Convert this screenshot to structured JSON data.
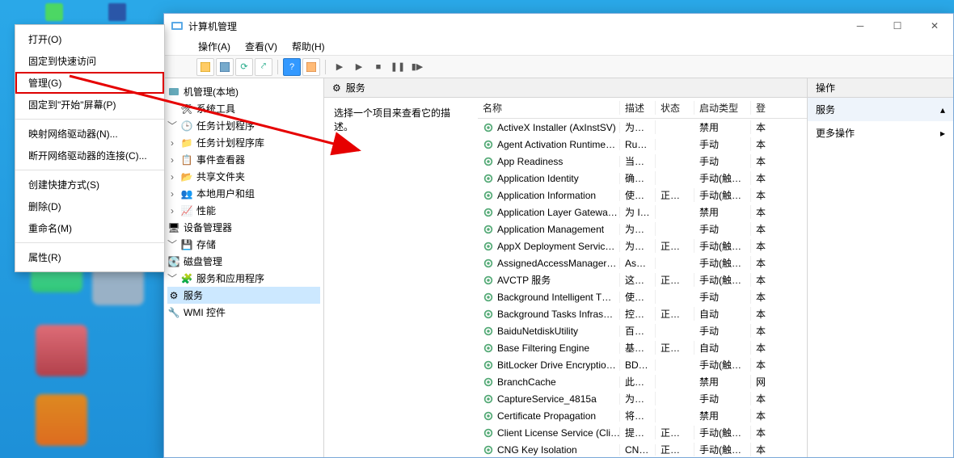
{
  "context_menu": {
    "items": [
      "打开(O)",
      "固定到快速访问",
      "管理(G)",
      "固定到\"开始\"屏幕(P)",
      "映射网络驱动器(N)...",
      "断开网络驱动器的连接(C)...",
      "创建快捷方式(S)",
      "删除(D)",
      "重命名(M)",
      "属性(R)"
    ]
  },
  "mmc": {
    "title": "计算机管理",
    "menus": [
      "操作(A)",
      "查看(V)",
      "帮助(H)"
    ],
    "tree": {
      "root": "机管理(本地)",
      "systools": "系统工具",
      "task_scheduler": "任务计划程序",
      "task_scheduler_lib": "任务计划程序库",
      "event_viewer": "事件查看器",
      "shared_folders": "共享文件夹",
      "local_users": "本地用户和组",
      "performance": "性能",
      "device_manager": "设备管理器",
      "storage": "存储",
      "disk_mgmt": "磁盘管理",
      "services_apps": "服务和应用程序",
      "services": "服务",
      "wmi": "WMI 控件"
    },
    "panel": {
      "title": "服务",
      "description": "选择一个项目来查看它的描述。"
    },
    "columns": [
      "名称",
      "描述",
      "状态",
      "启动类型",
      "登"
    ],
    "services": [
      {
        "name": "ActiveX Installer (AxInstSV)",
        "desc": "为从…",
        "status": "",
        "startup": "禁用",
        "ext": "本"
      },
      {
        "name": "Agent Activation Runtime…",
        "desc": "Runt…",
        "status": "",
        "startup": "手动",
        "ext": "本"
      },
      {
        "name": "App Readiness",
        "desc": "当用…",
        "status": "",
        "startup": "手动",
        "ext": "本"
      },
      {
        "name": "Application Identity",
        "desc": "确定…",
        "status": "",
        "startup": "手动(触发…",
        "ext": "本"
      },
      {
        "name": "Application Information",
        "desc": "使用…",
        "status": "正在…",
        "startup": "手动(触发…",
        "ext": "本"
      },
      {
        "name": "Application Layer Gatewa…",
        "desc": "为 In…",
        "status": "",
        "startup": "禁用",
        "ext": "本"
      },
      {
        "name": "Application Management",
        "desc": "为通…",
        "status": "",
        "startup": "手动",
        "ext": "本"
      },
      {
        "name": "AppX Deployment Servic…",
        "desc": "为部…",
        "status": "正在…",
        "startup": "手动(触发…",
        "ext": "本"
      },
      {
        "name": "AssignedAccessManager…",
        "desc": "Assi…",
        "status": "",
        "startup": "手动(触发…",
        "ext": "本"
      },
      {
        "name": "AVCTP 服务",
        "desc": "这是…",
        "status": "正在…",
        "startup": "手动(触发…",
        "ext": "本"
      },
      {
        "name": "Background Intelligent T…",
        "desc": "使用…",
        "status": "",
        "startup": "手动",
        "ext": "本"
      },
      {
        "name": "Background Tasks Infras…",
        "desc": "控制…",
        "status": "正在…",
        "startup": "自动",
        "ext": "本"
      },
      {
        "name": "BaiduNetdiskUtility",
        "desc": "百度…",
        "status": "",
        "startup": "手动",
        "ext": "本"
      },
      {
        "name": "Base Filtering Engine",
        "desc": "基本…",
        "status": "正在…",
        "startup": "自动",
        "ext": "本"
      },
      {
        "name": "BitLocker Drive Encryptio…",
        "desc": "BDE…",
        "status": "",
        "startup": "手动(触发…",
        "ext": "本"
      },
      {
        "name": "BranchCache",
        "desc": "此服…",
        "status": "",
        "startup": "禁用",
        "ext": "网"
      },
      {
        "name": "CaptureService_4815a",
        "desc": "为调…",
        "status": "",
        "startup": "手动",
        "ext": "本"
      },
      {
        "name": "Certificate Propagation",
        "desc": "将用…",
        "status": "",
        "startup": "禁用",
        "ext": "本"
      },
      {
        "name": "Client License Service (Cli…",
        "desc": "提供…",
        "status": "正在…",
        "startup": "手动(触发…",
        "ext": "本"
      },
      {
        "name": "CNG Key Isolation",
        "desc": "CNG…",
        "status": "正在…",
        "startup": "手动(触发…",
        "ext": "本"
      }
    ],
    "actions": {
      "header": "操作",
      "section": "服务",
      "more": "更多操作"
    }
  }
}
